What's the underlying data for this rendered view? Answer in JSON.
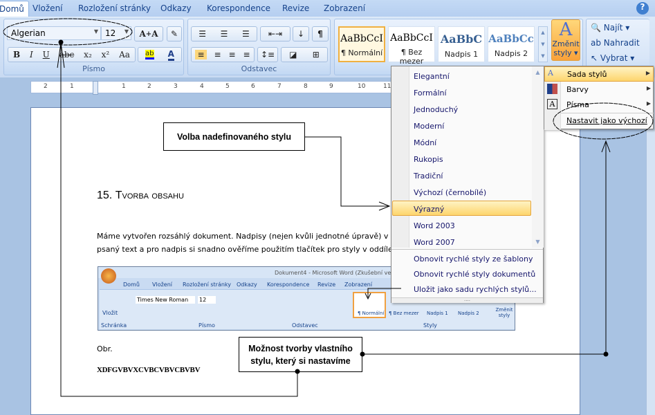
{
  "tabs": [
    "Domů",
    "Vložení",
    "Rozložení stránky",
    "Odkazy",
    "Korespondence",
    "Revize",
    "Zobrazení"
  ],
  "font": {
    "name": "Algerian",
    "size": "12",
    "group_label": "Písmo"
  },
  "paragraph": {
    "group_label": "Odstavec"
  },
  "styles": {
    "items": [
      {
        "sample": "AaBbCcI",
        "label": "¶ Normální"
      },
      {
        "sample": "AaBbCcI",
        "label": "¶ Bez mezer"
      },
      {
        "sample": "AaBbC",
        "label": "Nadpis 1"
      },
      {
        "sample": "AaBbCc",
        "label": "Nadpis 2"
      }
    ],
    "change_label": "Změnit",
    "change_label2": "styly"
  },
  "editing": {
    "find": "Najít",
    "replace": "Nahradit",
    "select": "Vybrat"
  },
  "style_set_menu": {
    "items": [
      "Elegantní",
      "Formální",
      "Jednoduchý",
      "Moderní",
      "Módní",
      "Rukopis",
      "Tradiční",
      "Výchozí (černobílé)",
      "Výrazný",
      "Word 2003",
      "Word 2007"
    ],
    "selected": "Výrazný",
    "actions": [
      "Obnovit rychlé styly ze šablony",
      "Obnovit rychlé styly dokumentů",
      "Uložit jako sadu rychlých stylů..."
    ]
  },
  "change_styles_menu": {
    "items": [
      "Sada stylů",
      "Barvy",
      "Písma",
      "Nastavit jako výchozí"
    ]
  },
  "document": {
    "heading_num": "15.",
    "heading": "Tvorba obsahu",
    "line1": "Máme vytvořen rozsáhlý dokument. Nadpisy (nejen kvůli jednotné úpravě) v",
    "line2": "psaný text a pro nadpis si snadno ověříme použitím tlačítek pro styly v oddíle „",
    "caption": "Obr.",
    "sample": "XDFGVBVXCVBCVBVCBVBV"
  },
  "embedded": {
    "title": "Dokument4 - Microsoft Word (Zkušební verze)",
    "tabs": [
      "Domů",
      "Vložení",
      "Rozložení stránky",
      "Odkazy",
      "Korespondence",
      "Revize",
      "Zobrazení"
    ],
    "font": "Times New Roman",
    "size": "12",
    "paste": "Vložit",
    "groups": [
      "Schránka",
      "Písmo",
      "Odstavec",
      "Styly"
    ],
    "styles": [
      "¶ Normální",
      "¶ Bez mezer",
      "Nadpis 1",
      "Nadpis 2"
    ],
    "change": "Změnit styly"
  },
  "callouts": {
    "predefined": "Volba nadefinovaného stylu",
    "custom_line1": "Možnost tvorby vlastního",
    "custom_line2": "stylu, který si nastavíme"
  },
  "ruler": [
    "2",
    "1",
    "1",
    "2",
    "3",
    "4",
    "5",
    "6",
    "7",
    "8",
    "9",
    "10",
    "11"
  ]
}
